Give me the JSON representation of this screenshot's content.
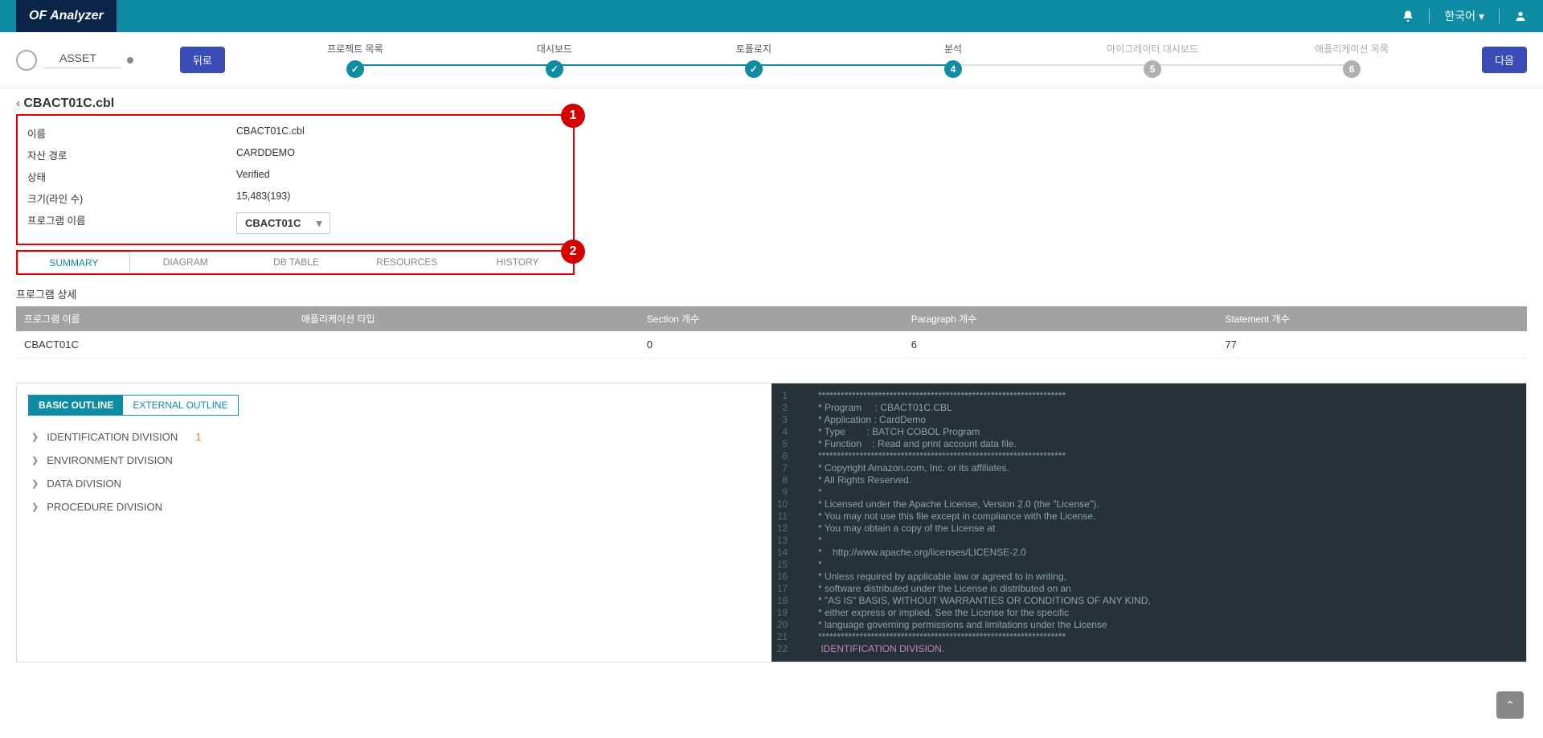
{
  "header": {
    "logo": "OF Analyzer",
    "language": "한국어"
  },
  "stepper": {
    "asset_label": "ASSET",
    "back": "뒤로",
    "next": "다음",
    "steps": [
      {
        "label": "프로젝트 목록",
        "state": "done"
      },
      {
        "label": "대시보드",
        "state": "done"
      },
      {
        "label": "토폴로지",
        "state": "done"
      },
      {
        "label": "분석",
        "state": "active",
        "num": "4"
      },
      {
        "label": "마이그레이터 대시보드",
        "state": "pending",
        "num": "5"
      },
      {
        "label": "애플리케이션 목록",
        "state": "pending",
        "num": "6"
      }
    ]
  },
  "breadcrumb": "CBACT01C.cbl",
  "info": {
    "rows": [
      {
        "label": "이름",
        "value": "CBACT01C.cbl"
      },
      {
        "label": "자산 경로",
        "value": "CARDDEMO"
      },
      {
        "label": "상태",
        "value": "Verified"
      },
      {
        "label": "크기(라인 수)",
        "value": "15,483(193)"
      }
    ],
    "program_label": "프로그램 이름",
    "program_value": "CBACT01C"
  },
  "markers": {
    "one": "1",
    "two": "2"
  },
  "tabs": [
    "SUMMARY",
    "DIAGRAM",
    "DB TABLE",
    "RESOURCES",
    "HISTORY"
  ],
  "detail_title": "프로그램 상세",
  "table": {
    "headers": [
      "프로그램 이름",
      "애플리케이션 타입",
      "Section 개수",
      "Paragraph 개수",
      "Statement 개수"
    ],
    "row": [
      "CBACT01C",
      "",
      "0",
      "6",
      "77"
    ]
  },
  "outline": {
    "tab_basic": "BASIC OUTLINE",
    "tab_external": "EXTERNAL OUTLINE",
    "items": [
      {
        "label": "IDENTIFICATION DIVISION",
        "count": "1"
      },
      {
        "label": "ENVIRONMENT DIVISION"
      },
      {
        "label": "DATA DIVISION"
      },
      {
        "label": "PROCEDURE DIVISION"
      }
    ]
  },
  "code": [
    {
      "n": "1",
      "t": "      ******************************************************************"
    },
    {
      "n": "2",
      "t": "      * Program     : CBACT01C.CBL"
    },
    {
      "n": "3",
      "t": "      * Application : CardDemo"
    },
    {
      "n": "4",
      "t": "      * Type        : BATCH COBOL Program"
    },
    {
      "n": "5",
      "t": "      * Function    : Read and print account data file."
    },
    {
      "n": "6",
      "t": "      ******************************************************************"
    },
    {
      "n": "7",
      "t": "      * Copyright Amazon.com, Inc. or its affiliates."
    },
    {
      "n": "8",
      "t": "      * All Rights Reserved."
    },
    {
      "n": "9",
      "t": "      *"
    },
    {
      "n": "10",
      "t": "      * Licensed under the Apache License, Version 2.0 (the \"License\")."
    },
    {
      "n": "11",
      "t": "      * You may not use this file except in compliance with the License."
    },
    {
      "n": "12",
      "t": "      * You may obtain a copy of the License at"
    },
    {
      "n": "13",
      "t": "      *"
    },
    {
      "n": "14",
      "t": "      *    http://www.apache.org/licenses/LICENSE-2.0"
    },
    {
      "n": "15",
      "t": "      *"
    },
    {
      "n": "16",
      "t": "      * Unless required by applicable law or agreed to in writing,"
    },
    {
      "n": "17",
      "t": "      * software distributed under the License is distributed on an"
    },
    {
      "n": "18",
      "t": "      * \"AS IS\" BASIS, WITHOUT WARRANTIES OR CONDITIONS OF ANY KIND,"
    },
    {
      "n": "19",
      "t": "      * either express or implied. See the License for the specific"
    },
    {
      "n": "20",
      "t": "      * language governing permissions and limitations under the License"
    },
    {
      "n": "21",
      "t": "      ******************************************************************"
    },
    {
      "n": "22",
      "t": "       ",
      "kw": "IDENTIFICATION DIVISION",
      "after": "."
    }
  ]
}
